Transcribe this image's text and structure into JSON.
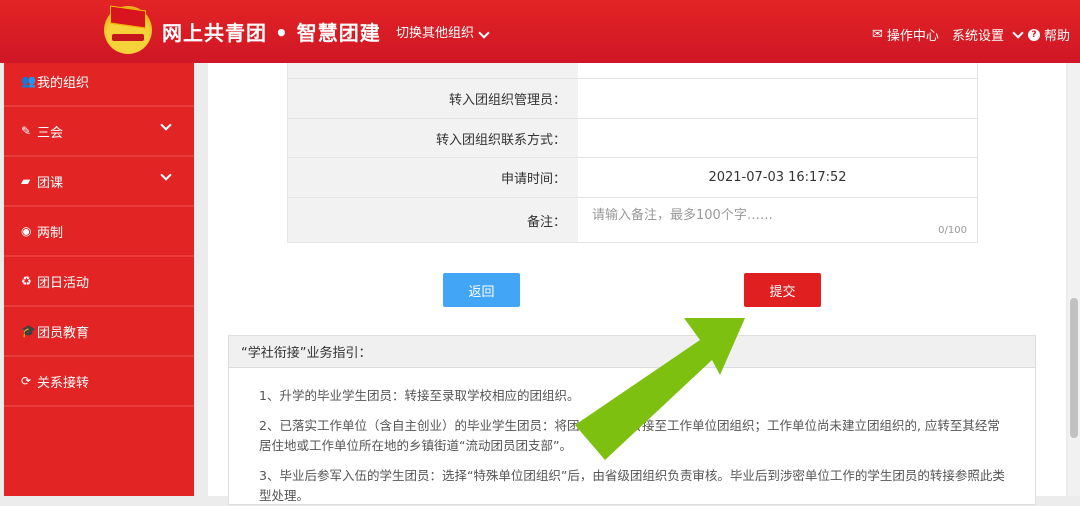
{
  "header": {
    "title": "网上共青团 • 智慧团建",
    "switch_org": "切换其他组织",
    "ops_center": "操作中心",
    "settings": "系统设置",
    "help": "帮助"
  },
  "sidebar": {
    "items": [
      {
        "label": "我的组织",
        "icon": "users-icon"
      },
      {
        "label": "三会",
        "icon": "edit-icon"
      },
      {
        "label": "团课",
        "icon": "folder-open-icon"
      },
      {
        "label": "两制",
        "icon": "dot-circle-icon"
      },
      {
        "label": "团日活动",
        "icon": "recycle-icon"
      },
      {
        "label": "团员教育",
        "icon": "graduation-cap-icon"
      },
      {
        "label": "关系接转",
        "icon": "refresh-icon"
      }
    ]
  },
  "form": {
    "admin_label": "转入团组织管理员：",
    "admin_value": "",
    "contact_label": "转入团组织联系方式：",
    "contact_value": "",
    "time_label": "申请时间：",
    "time_value": "2021-07-03 16:17:52",
    "note_label": "备注：",
    "note_placeholder": "请输入备注，最多100个字……",
    "note_counter": "0/100"
  },
  "buttons": {
    "back": "返回",
    "submit": "提交"
  },
  "guide": {
    "title": "“学社衔接”业务指引：",
    "items": [
      "1、升学的毕业学生团员：转接至录取学校相应的团组织。",
      "2、已落实工作单位（含自主创业）的毕业学生团员：将团组织关系转接至工作单位团组织；工作单位尚未建立团组织的, 应转至其经常居住地或工作单位所在地的乡镇街道“流动团员团支部”。",
      "3、毕业后参军入伍的学生团员：选择“特殊单位团组织”后，由省级团组织负责审核。毕业后到涉密单位工作的学生团员的转接参照此类型处理。"
    ]
  },
  "colors": {
    "brand": "#e22424",
    "back_button": "#42a5f5",
    "submit_button": "#e02020",
    "arrow": "#7dc00f"
  }
}
